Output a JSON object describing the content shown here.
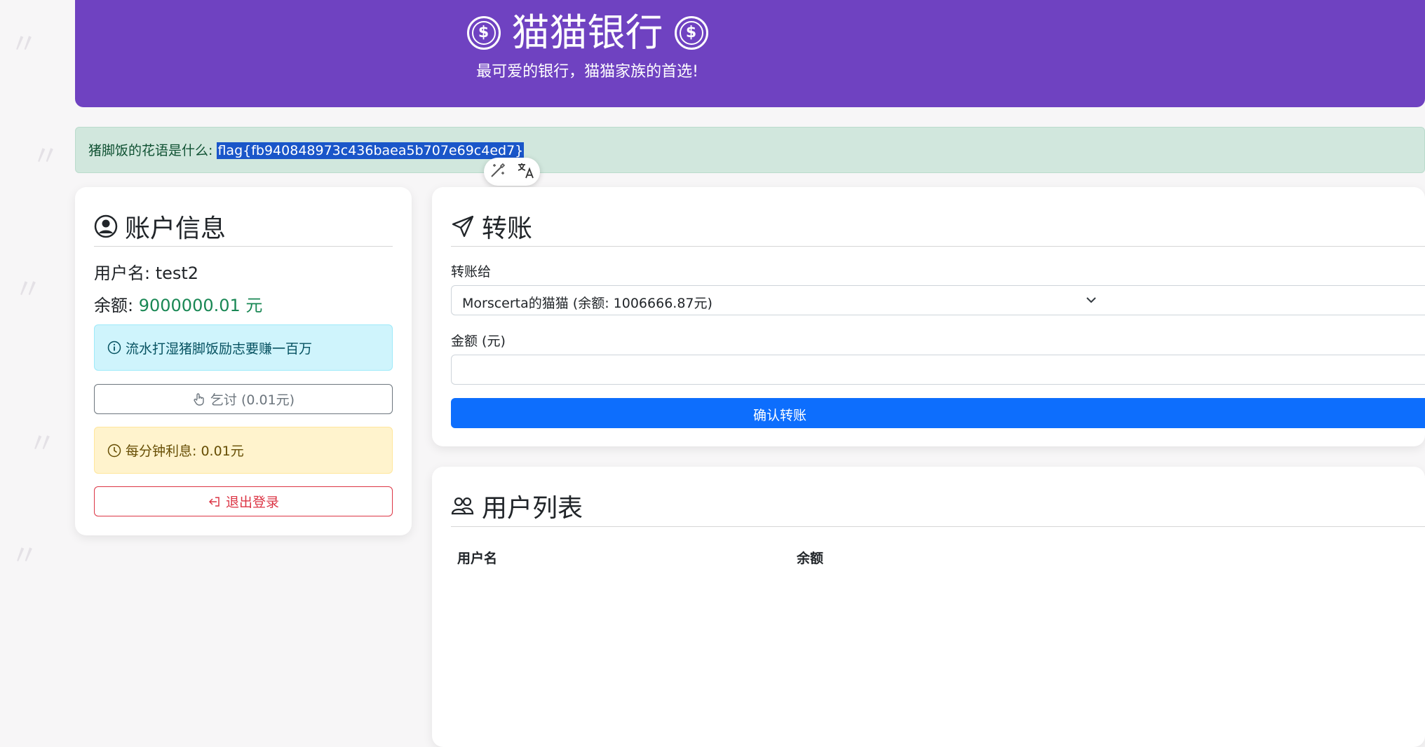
{
  "header": {
    "title": "猫猫银行",
    "tagline": "最可爱的银行，猫猫家族的首选!",
    "coin_symbol": "$"
  },
  "alert": {
    "question": "猪脚饭的花语是什么: ",
    "flag": "flag{fb940848973c436baea5b707e69c4ed7}"
  },
  "selection_toolbar": {
    "icons": [
      "magic-wand-icon",
      "translate-icon"
    ]
  },
  "account": {
    "title": "账户信息",
    "username_label": "用户名: ",
    "username": "test2",
    "balance_label": "余额: ",
    "balance": "9000000.01 元",
    "info_text": "流水打湿猪脚饭励志要赚一百万",
    "beg_button": "乞讨 (0.01元)",
    "interest_text": "每分钟利息: 0.01元",
    "logout_button": "退出登录"
  },
  "transfer": {
    "title": "转账",
    "to_label": "转账给",
    "to_selected": "Morscerta的猫猫 (余额: 1006666.87元)",
    "amount_label": "金额 (元)",
    "amount_value": "",
    "submit_label": "确认转账"
  },
  "userlist": {
    "title": "用户列表",
    "headers": [
      "用户名",
      "余额"
    ]
  },
  "colors": {
    "header": "#6f42c1",
    "primary": "#0d6efd",
    "success": "#198754",
    "danger": "#dc3545"
  }
}
